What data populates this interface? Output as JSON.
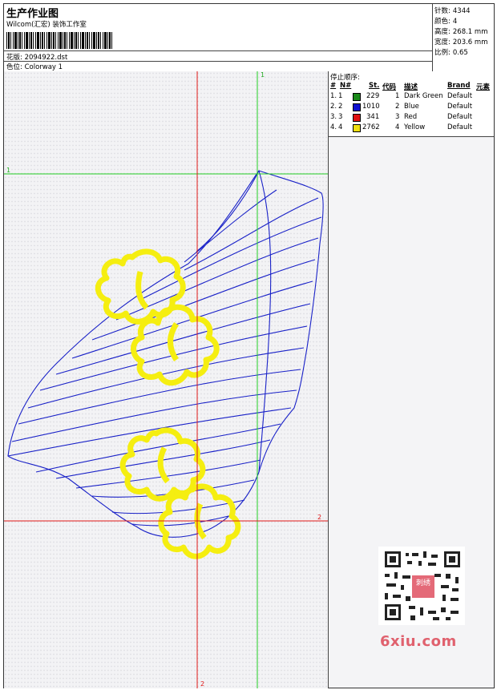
{
  "header": {
    "title": "生产作业图",
    "subtitle": "Wilcom(汇宏) 装饰工作室",
    "design_label": "花版:",
    "design_file": "2094922.dst",
    "colorway_label": "色位:",
    "colorway": "Colorway 1"
  },
  "stats": [
    {
      "label": "针数:",
      "value": "4344"
    },
    {
      "label": "颜色:",
      "value": "4"
    },
    {
      "label": "高度:",
      "value": "268.1 mm"
    },
    {
      "label": "宽度:",
      "value": "203.6 mm"
    },
    {
      "label": "比例:",
      "value": "0.65"
    }
  ],
  "legend": {
    "title": "停止顺序:",
    "columns": {
      "num": "#",
      "n": "N#",
      "st": "St.",
      "code": "代码",
      "desc": "描述",
      "brand": "Brand",
      "element": "元素"
    },
    "rows": [
      {
        "num": "1.",
        "n": "1",
        "color": "#1a8a1a",
        "st": "229",
        "code": "1",
        "desc": "Dark Green",
        "brand": "Default"
      },
      {
        "num": "2.",
        "n": "2",
        "color": "#1010d0",
        "st": "1010",
        "code": "2",
        "desc": "Blue",
        "brand": "Default"
      },
      {
        "num": "3.",
        "n": "3",
        "color": "#e01010",
        "st": "341",
        "code": "3",
        "desc": "Red",
        "brand": "Default"
      },
      {
        "num": "4.",
        "n": "4",
        "color": "#f0e010",
        "st": "2762",
        "code": "4",
        "desc": "Yellow",
        "brand": "Default"
      }
    ]
  },
  "guides": {
    "green_mark": "1",
    "red_mark": "2"
  },
  "colors": {
    "blue": "#1a22c8",
    "yellow": "#f5ee10",
    "green": "#22cc22",
    "red": "#e01818"
  },
  "watermark": "6xiu.com",
  "qr_badge": "刺绣"
}
